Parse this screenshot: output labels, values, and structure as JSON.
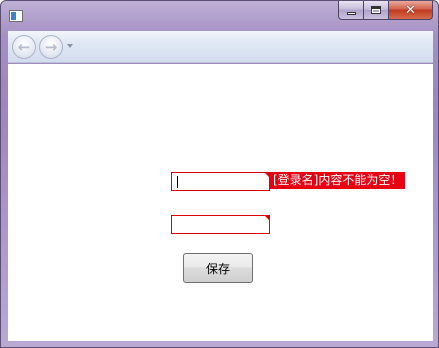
{
  "window": {
    "icon": "app-window-icon",
    "buttons": {
      "minimize_icon": "minimize-icon",
      "maximize_icon": "maximize-icon",
      "close_glyph": "✕"
    }
  },
  "navigation": {
    "back_glyph": "←",
    "forward_glyph": "→",
    "dropdown_icon": "chevron-down-icon"
  },
  "form": {
    "login_name": {
      "value": "",
      "error_message": "[登录名]内容不能为空！"
    },
    "second_field": {
      "value": ""
    },
    "save_label": "保存"
  },
  "colors": {
    "error": "#e60012",
    "field_border": "#e0000a"
  }
}
